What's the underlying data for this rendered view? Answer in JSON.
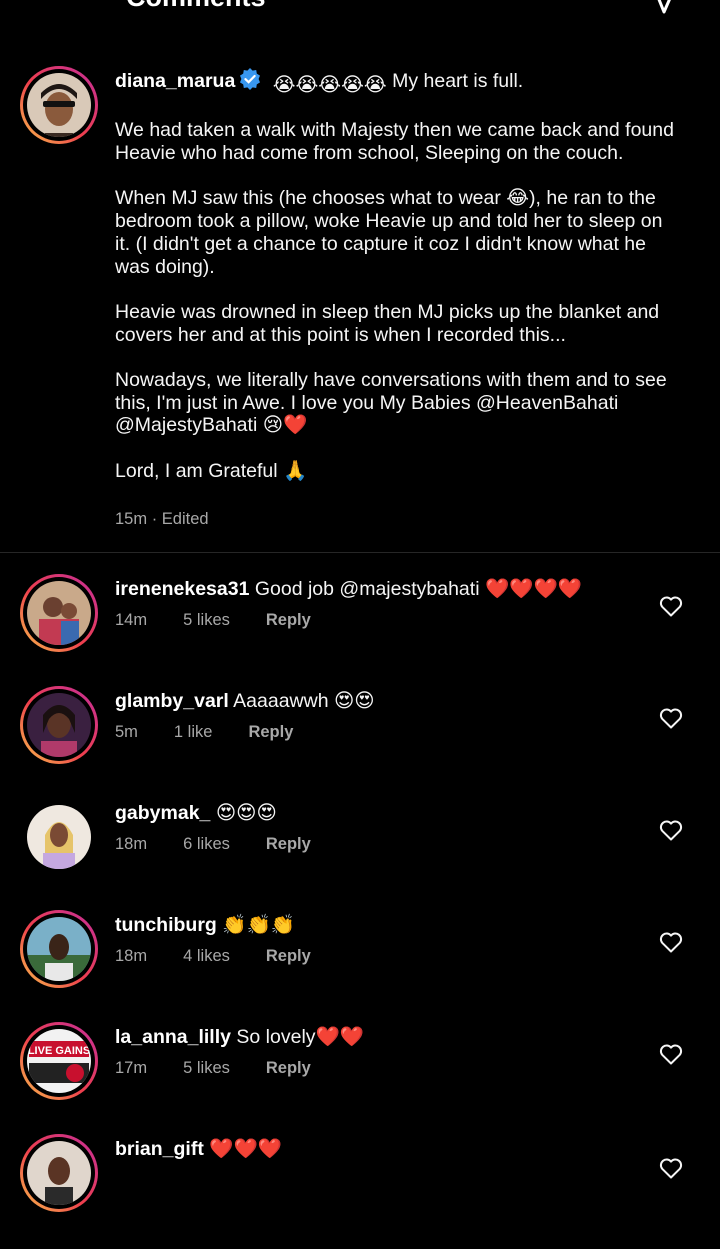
{
  "header": {
    "title": "Comments"
  },
  "caption": {
    "username": "diana_marua",
    "emojis": "😭😭😭😭😭",
    "first_line": "My heart is full.",
    "paragraphs": [
      "We had taken a walk with Majesty then we came back and found Heavie who had come from school, Sleeping on the couch.",
      "When MJ saw this (he chooses what to wear 😂), he ran to the bedroom took a pillow, woke Heavie up and told her to sleep on it. (I didn't get a chance to capture it coz I didn't know what he was doing).",
      "Heavie was drowned in sleep then MJ picks up the blanket and covers her and at this point is when I recorded this...",
      "Nowadays, we literally have  conversations with them and to see this, I'm just in Awe. I love you My Babies @HeavenBahati @MajestyBahati 😢❤️",
      "Lord, I am Grateful 🙏"
    ],
    "time": "15m",
    "edited": "Edited"
  },
  "comments": [
    {
      "username": "irenenekesa31",
      "text": "Good job @majestybahati ❤️❤️❤️❤️",
      "time": "14m",
      "likes": "5 likes",
      "reply": "Reply"
    },
    {
      "username": "glamby_varl",
      "text": "Aaaaawwh 😍😍",
      "time": "5m",
      "likes": "1 like",
      "reply": "Reply"
    },
    {
      "username": "gabymak_",
      "text": "😍😍😍",
      "time": "18m",
      "likes": "6 likes",
      "reply": "Reply"
    },
    {
      "username": "tunchiburg",
      "text": "👏👏👏",
      "time": "18m",
      "likes": "4 likes",
      "reply": "Reply"
    },
    {
      "username": "la_anna_lilly",
      "text": "So lovely❤️❤️",
      "time": "17m",
      "likes": "5 likes",
      "reply": "Reply"
    },
    {
      "username": "brian_gift",
      "text": "❤️❤️❤️",
      "time": "",
      "likes": "",
      "reply": ""
    }
  ],
  "avatar_badge_text": "LIVE GAINS",
  "colors": {
    "background": "#000000",
    "text": "#f5f5f5",
    "meta": "#a8a8a8",
    "verified": "#3897f0"
  }
}
